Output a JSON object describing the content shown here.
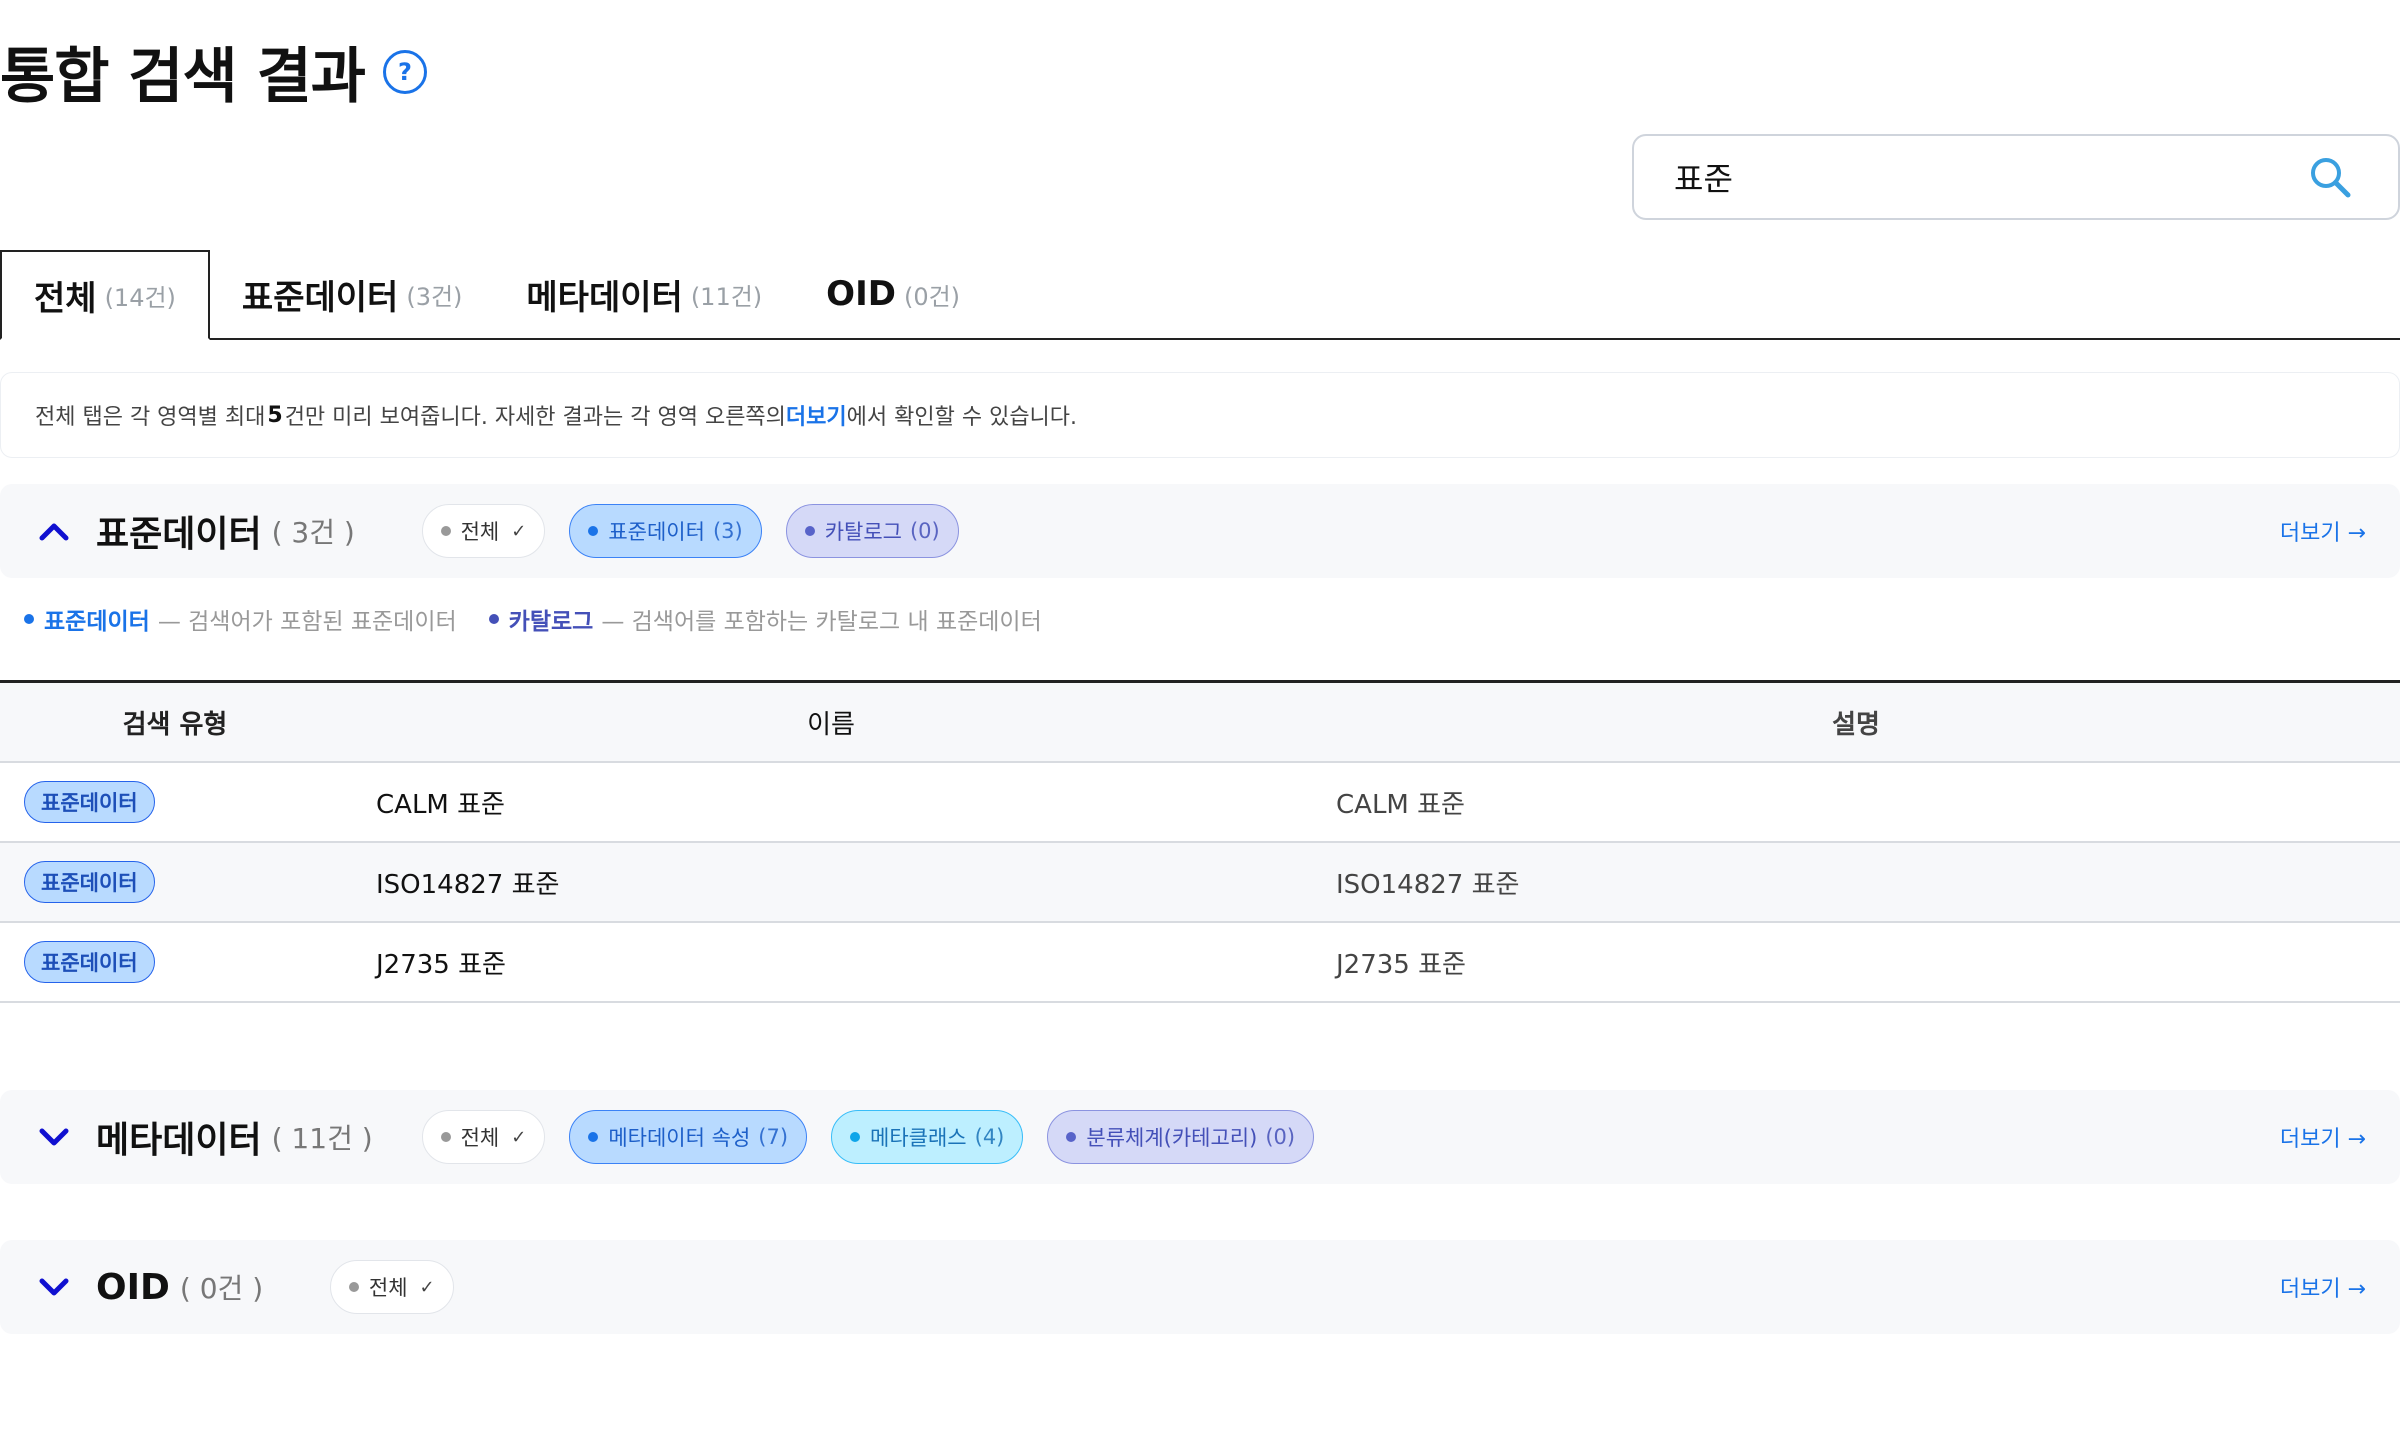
{
  "page": {
    "title": "통합 검색 결과",
    "help_label": "?"
  },
  "search": {
    "value": "표준",
    "placeholder": ""
  },
  "tabs": [
    {
      "label": "전체",
      "count": "(14건)"
    },
    {
      "label": "표준데이터",
      "count": "(3건)"
    },
    {
      "label": "메타데이터",
      "count": "(11건)"
    },
    {
      "label": "OID",
      "count": "(0건)"
    }
  ],
  "notice": {
    "prefix": "전체 탭은 각 영역별 최대 ",
    "bold": "5",
    "middle": "건만 미리 보여줍니다. 자세한 결과는 각 영역 오른쪽의 ",
    "link": "더보기",
    "suffix": "에서 확인할 수 있습니다."
  },
  "sections": {
    "standard": {
      "title": "표준데이터",
      "count": "( 3건 )",
      "more": "더보기 →",
      "filters": {
        "all": "전체",
        "f1_label": "표준데이터",
        "f1_count": "(3)",
        "f2_label": "카탈로그",
        "f2_count": "(0)"
      },
      "legend": {
        "l1_name": "표준데이터",
        "l1_desc": "— 검색어가 포함된 표준데이터",
        "l2_name": "카탈로그",
        "l2_desc": "— 검색어를 포함하는 카탈로그 내 표준데이터"
      },
      "table": {
        "headers": [
          "검색 유형",
          "이름",
          "설명"
        ],
        "rows": [
          {
            "type": "표준데이터",
            "name": "CALM 표준",
            "desc": "CALM 표준"
          },
          {
            "type": "표준데이터",
            "name": "ISO14827 표준",
            "desc": "ISO14827 표준"
          },
          {
            "type": "표준데이터",
            "name": "J2735 표준",
            "desc": "J2735 표준"
          }
        ]
      }
    },
    "meta": {
      "title": "메타데이터",
      "count": "( 11건 )",
      "more": "더보기 →",
      "filters": {
        "all": "전체",
        "f1_label": "메타데이터 속성",
        "f1_count": "(7)",
        "f2_label": "메타클래스",
        "f2_count": "(4)",
        "f3_label": "분류체계(카테고리)",
        "f3_count": "(0)"
      }
    },
    "oid": {
      "title": "OID",
      "count": "( 0건 )",
      "more": "더보기 →",
      "filters": {
        "all": "전체"
      }
    }
  },
  "colors": {
    "accent": "#1a73e8",
    "chip_blue_bg": "#b8daff",
    "chip_cyan_bg": "#bdefff",
    "chip_purple_bg": "#d5d9f7"
  }
}
